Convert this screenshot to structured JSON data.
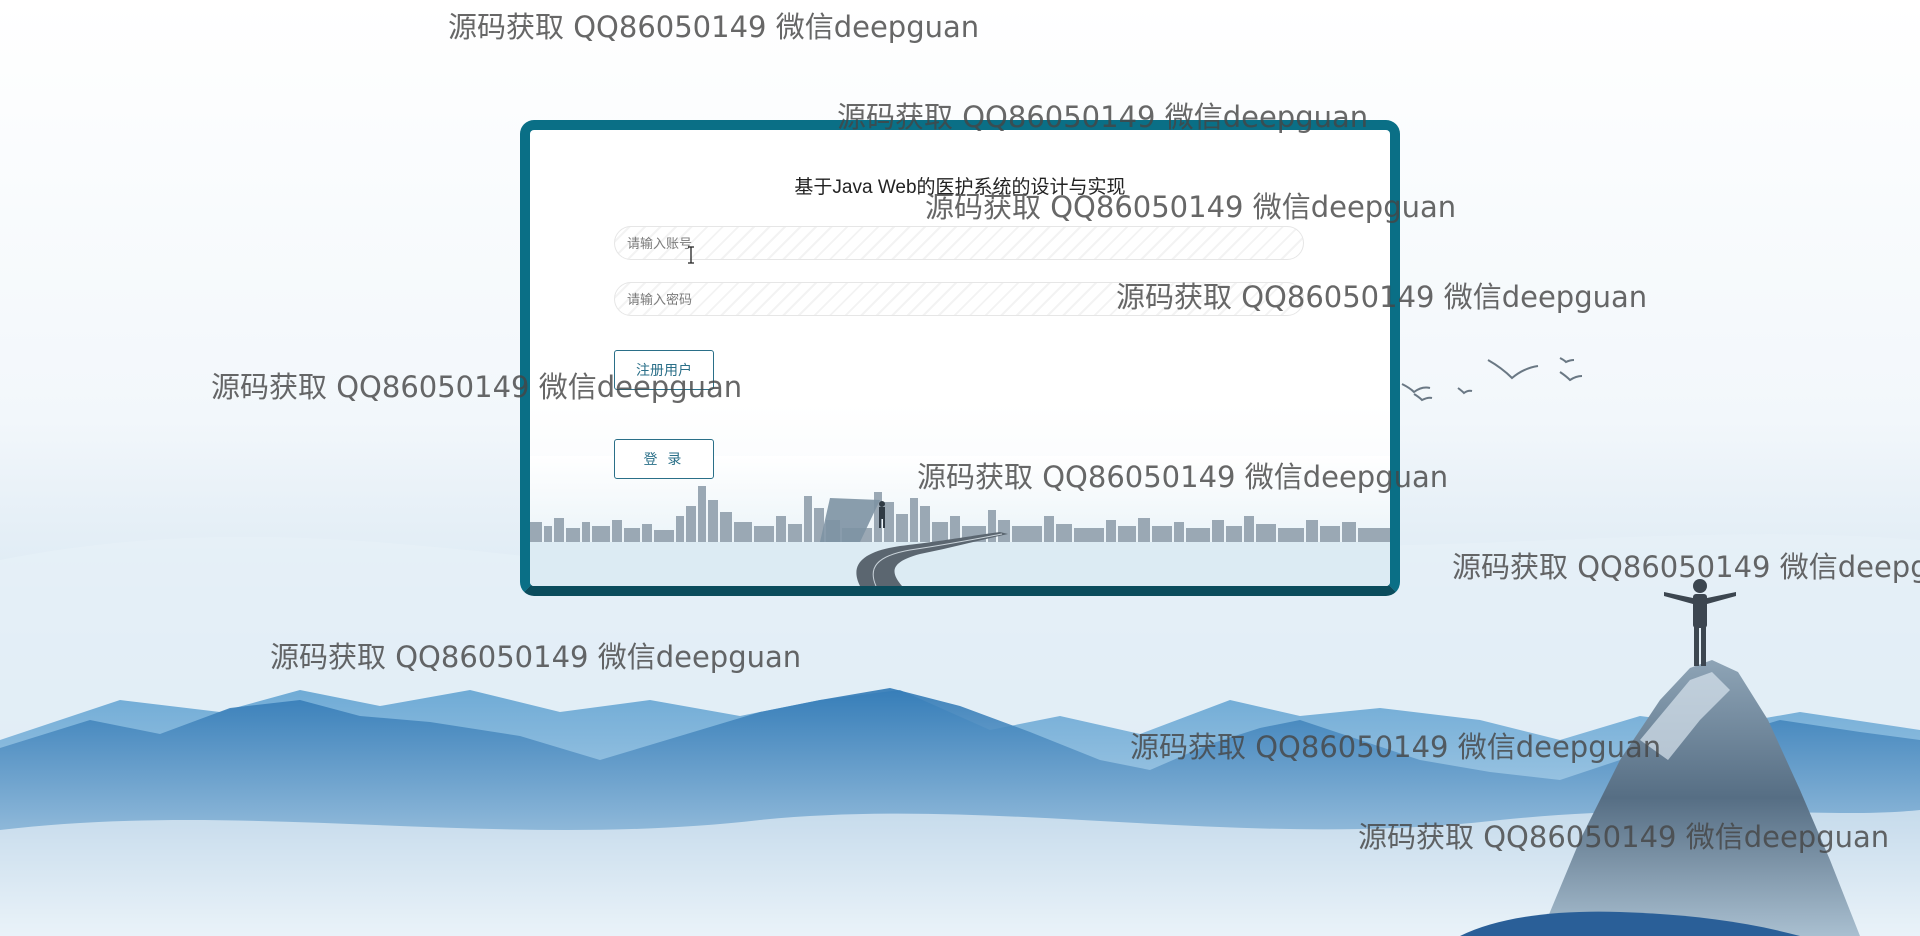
{
  "login": {
    "title": "基于Java Web的医护系统的设计与实现",
    "account_placeholder": "请输入账号",
    "password_placeholder": "请输入密码",
    "register_label": "注册用户",
    "login_label": "登 录"
  },
  "watermark": {
    "text": "源码获取 QQ86050149 微信deepguan"
  },
  "colors": {
    "card_border": "#0a6f86",
    "button_text": "#2a6f88",
    "sky": "#eef5fa",
    "mountain": "#3c86bf"
  }
}
